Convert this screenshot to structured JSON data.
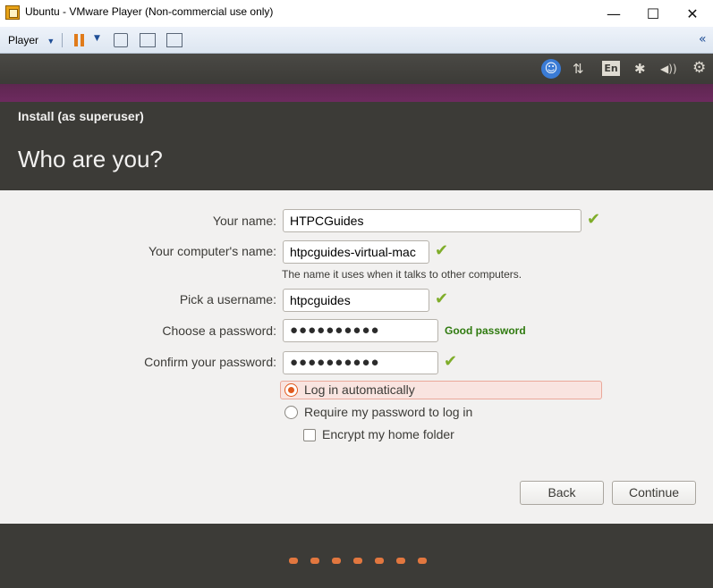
{
  "window": {
    "title": "Ubuntu - VMware Player (Non-commercial use only)",
    "minimize": "—",
    "maximize": "☐",
    "close": "✕"
  },
  "toolbar": {
    "player_menu": "Player",
    "dropdown_glyph": "▼",
    "collapse_glyph": "«"
  },
  "panel": {
    "a11y_glyph": "☺",
    "network_glyph": "⇅",
    "language": "En",
    "bluetooth_glyph": "✱",
    "sound_glyph": "◀))",
    "settings_glyph": "⚙"
  },
  "installer": {
    "window_title": "Install (as superuser)",
    "heading": "Who are you?"
  },
  "form": {
    "name_label": "Your name:",
    "name_value": "HTPCGuides",
    "computer_label": "Your computer's name:",
    "computer_value": "htpcguides-virtual-mac",
    "computer_hint": "The name it uses when it talks to other computers.",
    "username_label": "Pick a username:",
    "username_value": "htpcguides",
    "password_label": "Choose a password:",
    "password_value": "●●●●●●●●●●",
    "password_strength": "Good password",
    "confirm_label": "Confirm your password:",
    "confirm_value": "●●●●●●●●●●",
    "check_glyph": "✔",
    "login_auto": "Log in automatically",
    "login_auto_selected": true,
    "require_password": "Require my password to log in",
    "encrypt_home": "Encrypt my home folder",
    "encrypt_checked": false
  },
  "buttons": {
    "back": "Back",
    "continue": "Continue"
  },
  "colors": {
    "accent_orange": "#e05a1e",
    "ubuntu_purple": "#5e2750",
    "check_green": "#7fad2a",
    "dark_panel": "#3c3b37"
  }
}
